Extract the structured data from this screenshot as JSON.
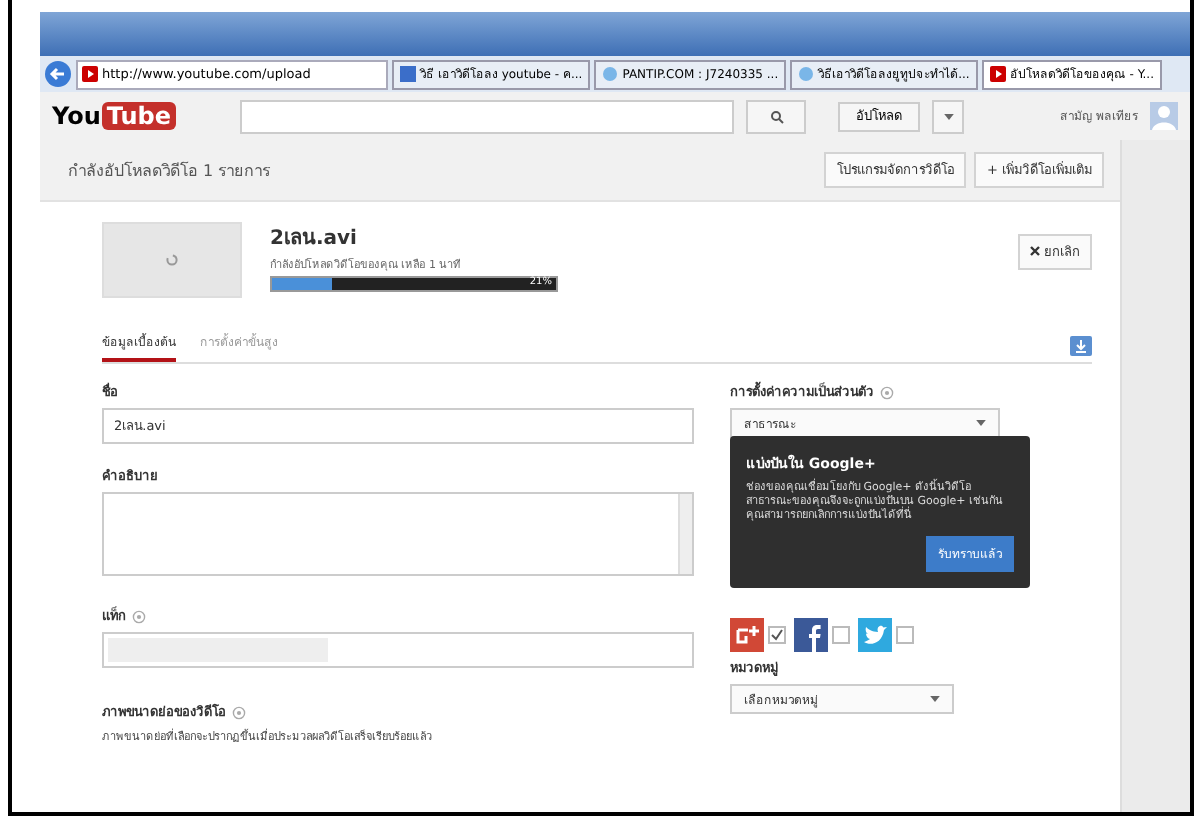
{
  "browser": {
    "url": "http://www.youtube.com/upload",
    "tabs": [
      {
        "title": "วิธี เอาวิดีโอลง youtube - ค...",
        "selected": false,
        "kind": "site"
      },
      {
        "title": "PANTIP.COM : J7240335 ...",
        "selected": false,
        "kind": "ie"
      },
      {
        "title": "วิธีเอาวิดีโอลงยูทูปจะทำได้...",
        "selected": false,
        "kind": "ie"
      },
      {
        "title": "อัปโหลดวิดีโอของคุณ - Y...",
        "selected": true,
        "kind": "youtube"
      }
    ]
  },
  "header": {
    "logo_left": "You",
    "logo_right": "Tube",
    "upload_button": "อัปโหลด",
    "user_name": "สามัญ พลเทียร"
  },
  "upload_panel": {
    "title": "กำลังอัปโหลดวิดีโอ 1 รายการ",
    "buttons": [
      "โปรแกรมจัดการวิดีโอ",
      "+ เพิ่มวิดีโอเพิ่มเติม"
    ],
    "file": {
      "name": "2เลน.avi",
      "status": "กำลังอัปโหลดวิดีโอของคุณ เหลือ 1 นาที",
      "level": 0.21,
      "percent": "21%",
      "cancel": "ยกเลิก"
    },
    "tabs": [
      {
        "label": "ข้อมูลเบื้องต้น",
        "selected": true
      },
      {
        "label": "การตั้งค่าขั้นสูง",
        "selected": false
      }
    ]
  },
  "form": {
    "title_label": "ชื่อ",
    "title_value": "2เลน.avi",
    "description_label": "คำอธิบาย",
    "tags_label": "แท็ก",
    "thumbnail_label": "ภาพขนาดย่อของวิดีโอ",
    "thumbnail_note": "ภาพขนาดย่อที่เลือกจะปรากฏขึ้นเมื่อประมวลผลวิดีโอเสร็จเรียบร้อยแล้ว",
    "privacy_label": "การตั้งค่าความเป็นส่วนตัว",
    "privacy_value": "สาธารณะ",
    "share": [
      {
        "kind": "googleplus",
        "checked": true
      },
      {
        "kind": "facebook",
        "checked": false
      },
      {
        "kind": "twitter",
        "checked": false
      }
    ],
    "category_label": "หมวดหมู่",
    "category_value": "เลือกหมวดหมู่"
  },
  "popup": {
    "title": "แบ่งปันใน Google+",
    "text": "ช่องของคุณเชื่อมโยงกับ Google+ ดังนั้นวิดีโอสาธารณะของคุณจึงจะถูกแบ่งปันบน Google+ เช่นกัน คุณสามารถยกเลิกการแบ่งปันได้ที่นี่",
    "button": "รับทราบแล้ว"
  }
}
